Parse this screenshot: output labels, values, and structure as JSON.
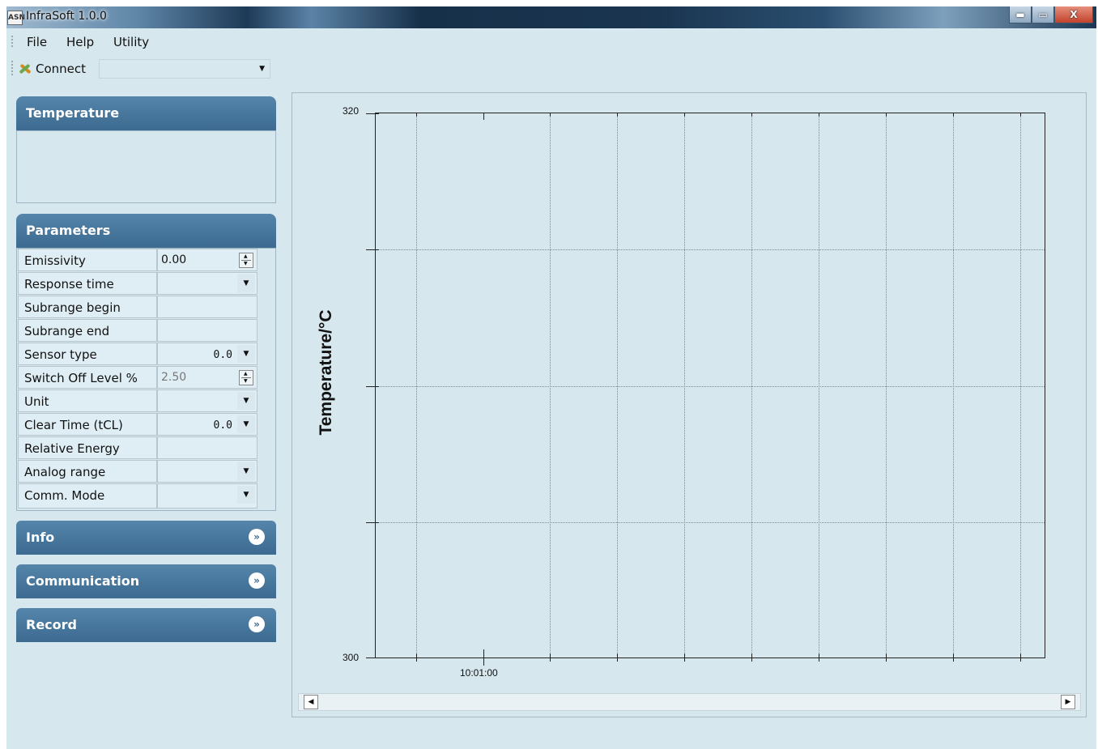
{
  "window": {
    "title": "InfraSoft 1.0.0",
    "logo_text": "ASN",
    "minimize": "▬",
    "maximize": "▭",
    "close": "X"
  },
  "menu": {
    "items": [
      "File",
      "Help",
      "Utility"
    ]
  },
  "toolbar": {
    "connect_label": "Connect",
    "port_value": ""
  },
  "panels": {
    "temperature": {
      "title": "Temperature"
    },
    "parameters": {
      "title": "Parameters",
      "rows": [
        {
          "label": "Emissivity",
          "value": "0.00",
          "control": "spin"
        },
        {
          "label": "Response time",
          "value": "",
          "control": "dropdown"
        },
        {
          "label": "Subrange begin",
          "value": "",
          "control": "none"
        },
        {
          "label": "Subrange end",
          "value": "",
          "control": "none"
        },
        {
          "label": "Sensor type",
          "value": "0.0",
          "control": "dropdown"
        },
        {
          "label": "Switch Off Level %",
          "value": "2.50",
          "control": "spin"
        },
        {
          "label": "Unit",
          "value": "",
          "control": "dropdown"
        },
        {
          "label": "Clear Time (tCL)",
          "value": "0.0",
          "control": "dropdown"
        },
        {
          "label": "Relative Energy",
          "value": "",
          "control": "none"
        },
        {
          "label": "Analog range",
          "value": "",
          "control": "dropdown"
        },
        {
          "label": "Comm. Mode",
          "value": "",
          "control": "dropdown"
        }
      ]
    },
    "info": {
      "title": "Info"
    },
    "communication": {
      "title": "Communication"
    },
    "record": {
      "title": "Record"
    }
  },
  "chart_data": {
    "type": "line",
    "title": "",
    "ylabel": "Temperature/°C",
    "xlabel": "",
    "ylim": [
      300,
      320
    ],
    "y_tick_labels": [
      "320",
      "300"
    ],
    "x_tick_labels": [
      "10:01:00"
    ],
    "grid": true,
    "series": []
  },
  "scrollbar": {
    "left_arrow": "◀",
    "right_arrow": "▶"
  }
}
